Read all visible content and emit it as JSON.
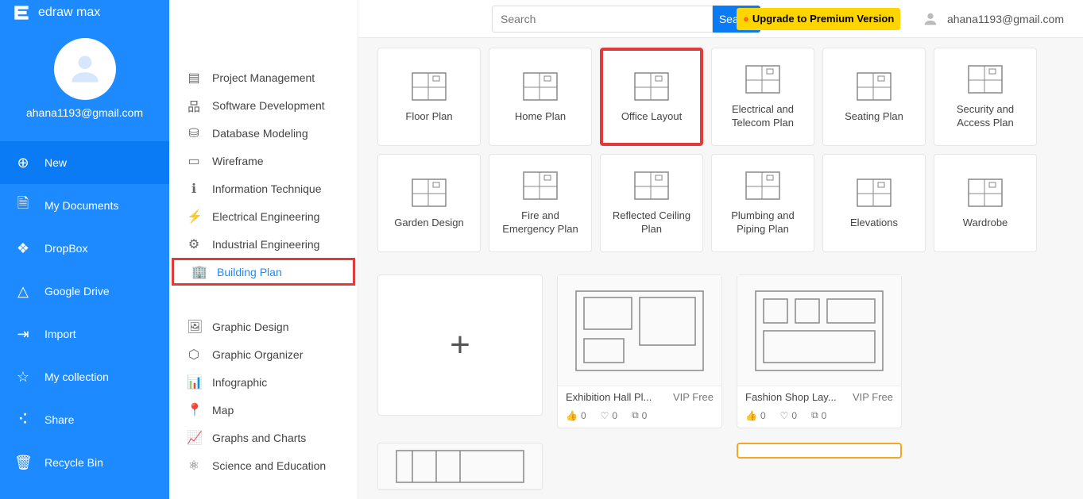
{
  "logo_text": "edraw max",
  "user_email": "ahana1193@gmail.com",
  "top_user_email": "ahana1193@gmail.com",
  "search_placeholder": "Search",
  "search_button": "Search",
  "upgrade_text": "Upgrade to Premium Version",
  "nav_blue": {
    "new": "New",
    "documents": "My Documents",
    "dropbox": "DropBox",
    "gdrive": "Google Drive",
    "import": "Import",
    "collection": "My collection",
    "share": "Share",
    "recycle": "Recycle Bin"
  },
  "categories": {
    "group1": [
      {
        "icon": "project",
        "label": "Project Management"
      },
      {
        "icon": "software",
        "label": "Software Development"
      },
      {
        "icon": "db",
        "label": "Database Modeling"
      },
      {
        "icon": "wireframe",
        "label": "Wireframe"
      },
      {
        "icon": "info",
        "label": "Information Technique"
      },
      {
        "icon": "elec",
        "label": "Electrical Engineering"
      },
      {
        "icon": "ind",
        "label": "Industrial Engineering"
      },
      {
        "icon": "building",
        "label": "Building Plan",
        "selected": true
      }
    ],
    "group2": [
      {
        "icon": "graphic",
        "label": "Graphic Design"
      },
      {
        "icon": "org",
        "label": "Graphic Organizer"
      },
      {
        "icon": "infog",
        "label": "Infographic"
      },
      {
        "icon": "map",
        "label": "Map"
      },
      {
        "icon": "charts",
        "label": "Graphs and Charts"
      },
      {
        "icon": "science",
        "label": "Science and Education"
      }
    ]
  },
  "cards": [
    {
      "label": "Floor Plan"
    },
    {
      "label": "Home Plan"
    },
    {
      "label": "Office Layout",
      "hilite": true
    },
    {
      "label": "Electrical and Telecom Plan"
    },
    {
      "label": "Seating Plan"
    },
    {
      "label": "Security and Access Plan"
    },
    {
      "label": "Garden Design"
    },
    {
      "label": "Fire and Emergency Plan"
    },
    {
      "label": "Reflected Ceiling Plan"
    },
    {
      "label": "Plumbing and Piping Plan"
    },
    {
      "label": "Elevations"
    },
    {
      "label": "Wardrobe"
    }
  ],
  "templates": [
    {
      "title": "Exhibition Hall Pl...",
      "tag": "VIP Free",
      "likes": "0",
      "favs": "0",
      "copies": "0"
    },
    {
      "title": "Fashion Shop Lay...",
      "tag": "VIP Free",
      "likes": "0",
      "favs": "0",
      "copies": "0"
    }
  ]
}
